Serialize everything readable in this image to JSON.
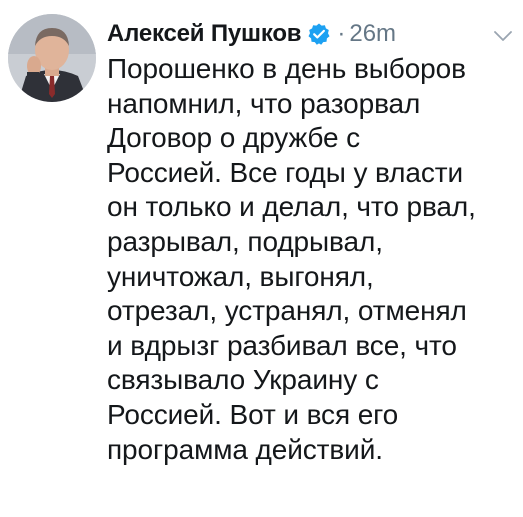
{
  "tweet": {
    "author_name": "Алексей Пушков",
    "separator": "·",
    "time": "26m",
    "lines": [
      "Порошенко в день выборов",
      "напомнил, что разорвал",
      "Договор о дружбе с",
      "Россией. Все годы у власти",
      "он только и делал, что рвал,",
      "разрывал, подрывал,",
      "уничтожал, выгонял,",
      "отрезал, устранял, отменял",
      "и вдрызг разбивал все, что",
      "связывало Украину с",
      "Россией. Вот и вся его",
      "программа действий."
    ]
  },
  "icons": {
    "verified": "verified-badge-icon",
    "menu": "chevron-down-icon"
  },
  "colors": {
    "verified_blue": "#1da1f2",
    "secondary_gray": "#657786",
    "text": "#14171a"
  }
}
